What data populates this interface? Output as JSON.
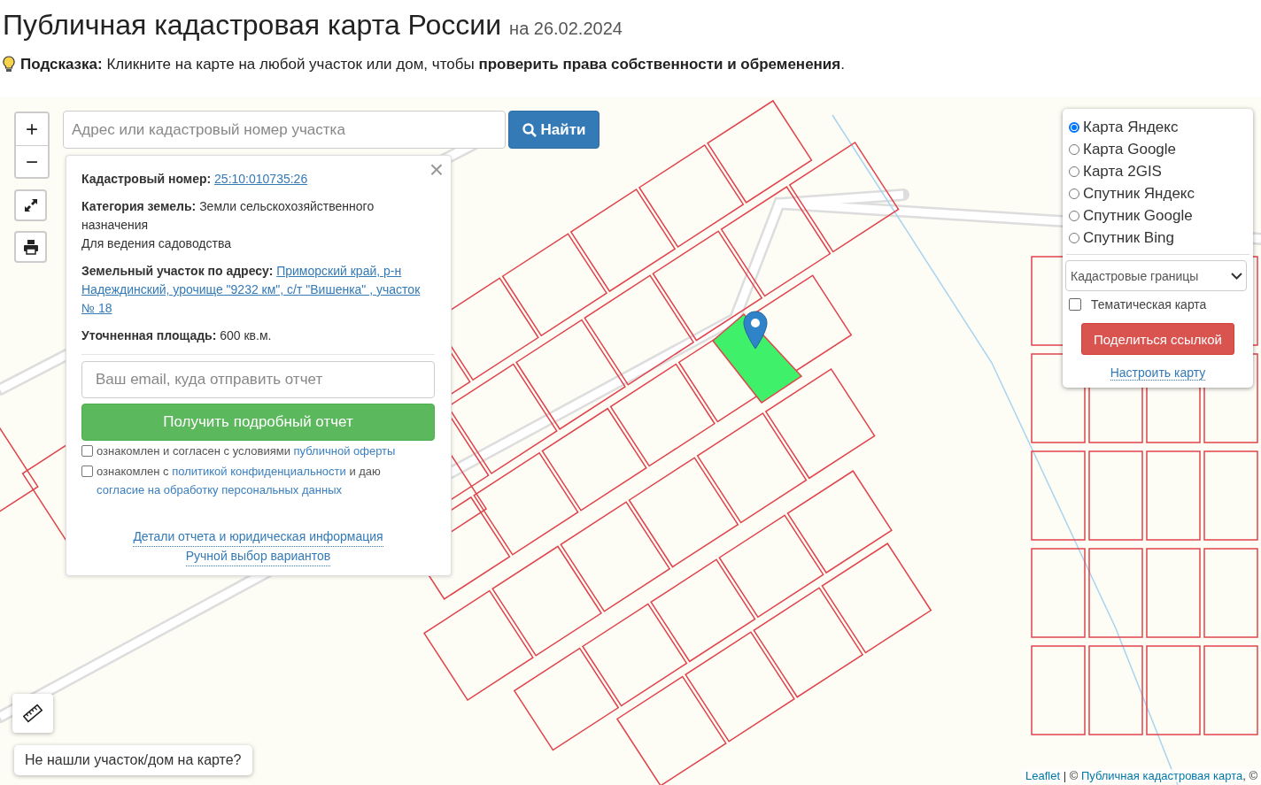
{
  "page": {
    "title": "Публичная кадастровая карта России",
    "date": "на 26.02.2024"
  },
  "hint": "**Подсказка:** Кликните на карте на любой участок или дом, чтобы **проверить права собственности и обременения**.",
  "search": {
    "placeholder": "Адрес или кадастровый номер участка",
    "button": "Найти"
  },
  "map_controls": {
    "zoom_in": "+",
    "zoom_out": "−"
  },
  "popup": {
    "close": "×",
    "fields": [
      {
        "kind": "link",
        "label": "Кадастровый номер:",
        "value": "25:10:010735:26"
      },
      {
        "kind": "text",
        "label": "Категория земель:",
        "value": "Земли сельскохозяйственного назначения"
      },
      {
        "kind": "note",
        "value": "Для ведения садоводства"
      },
      {
        "kind": "address",
        "label": "Земельный участок по адресу:",
        "value": "Приморский край, р-н Надеждинский, урочище \"9232 км\", с/т \"Вишенка\" , участок № 18"
      },
      {
        "kind": "text",
        "label": "Уточненная площадь:",
        "value": "600 кв.м."
      }
    ],
    "email_placeholder": "Ваш email, куда отправить отчет",
    "report_button": "Получить подробный отчет",
    "agreements": [
      {
        "checked": false,
        "parts": [
          {
            "text": "ознакомлен и согласен с условиями ",
            "link": false
          },
          {
            "text": "публичной оферты",
            "link": true
          }
        ]
      },
      {
        "checked": false,
        "parts": [
          {
            "text": "ознакомлен с ",
            "link": false
          },
          {
            "text": "политикой конфиденциальности",
            "link": true
          },
          {
            "text": " и даю ",
            "link": false
          },
          {
            "text": "согласие на обработку персональных данных",
            "link": true
          }
        ]
      }
    ],
    "links": [
      "Детали отчета и юридическая информация",
      "Ручной выбор вариантов"
    ]
  },
  "layers": {
    "base_maps": [
      {
        "label": "Карта Яндекс",
        "selected": true
      },
      {
        "label": "Карта Google",
        "selected": false
      },
      {
        "label": "Карта 2GIS",
        "selected": false
      },
      {
        "label": "Спутник Яндекс",
        "selected": false
      },
      {
        "label": "Спутник Google",
        "selected": false
      },
      {
        "label": "Спутник Bing",
        "selected": false
      }
    ],
    "overlay_select": "Кадастровые границы",
    "thematic": {
      "label": "Тематическая карта",
      "checked": false
    },
    "share_button": "Поделиться ссылкой",
    "settings_link": "Настроить карту"
  },
  "not_found_button": "Не нашли участок/дом на карте?",
  "attribution": [
    {
      "text": "Leaflet",
      "link": true
    },
    {
      "text": " | © ",
      "link": false
    },
    {
      "text": "Публичная кадастровая карта",
      "link": true
    },
    {
      "text": ", ©",
      "link": false
    }
  ]
}
